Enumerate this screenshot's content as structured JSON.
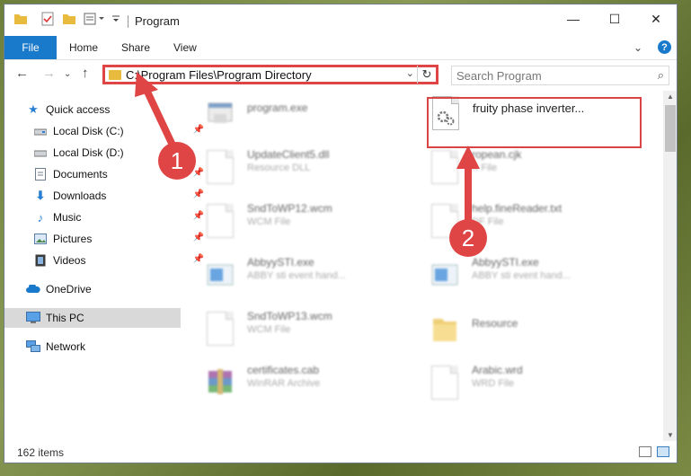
{
  "window": {
    "title": "Program",
    "controls": {
      "minimize": "—",
      "maximize": "☐",
      "close": "✕"
    }
  },
  "ribbon": {
    "tabs": [
      "File",
      "Home",
      "Share",
      "View"
    ],
    "help": "?"
  },
  "nav": {
    "address_path": "C:\\Program Files\\Program Directory",
    "search_placeholder": "Search Program"
  },
  "sidebar": {
    "items": [
      {
        "label": "Quick access",
        "icon": "star-icon",
        "pinned": false
      },
      {
        "label": "Local Disk (C:)",
        "icon": "drive-icon",
        "pinned": true
      },
      {
        "label": "Local Disk (D:)",
        "icon": "drive-icon",
        "pinned": false
      },
      {
        "label": "Documents",
        "icon": "documents-icon",
        "pinned": true
      },
      {
        "label": "Downloads",
        "icon": "download-icon",
        "pinned": true
      },
      {
        "label": "Music",
        "icon": "music-icon",
        "pinned": true
      },
      {
        "label": "Pictures",
        "icon": "pictures-icon",
        "pinned": true
      },
      {
        "label": "Videos",
        "icon": "videos-icon",
        "pinned": true
      },
      {
        "label": "OneDrive",
        "icon": "cloud-icon",
        "pinned": false
      },
      {
        "label": "This PC",
        "icon": "computer-icon",
        "pinned": false,
        "selected": true
      },
      {
        "label": "Network",
        "icon": "network-icon",
        "pinned": false
      }
    ]
  },
  "files": [
    {
      "name": "program.exe",
      "type": "",
      "icon": "exe-icon"
    },
    {
      "name": "fruity phase inverter...",
      "type": "",
      "icon": "settings-file-icon"
    },
    {
      "name": "UpdateClient5.dll",
      "type": "Resource DLL",
      "icon": "dll-icon"
    },
    {
      "name": "ropean.cjk",
      "type": "K File",
      "icon": "file-icon"
    },
    {
      "name": "SndToWP12.wcm",
      "type": "WCM File",
      "icon": "file-icon"
    },
    {
      "name": "help.fineReader.txt",
      "type": "DF File",
      "icon": "file-icon"
    },
    {
      "name": "AbbyySTI.exe",
      "type": "ABBY sti event hand...",
      "icon": "app-icon"
    },
    {
      "name": "AbbyySTI.exe",
      "type": "ABBY sti event hand...",
      "icon": "app-icon"
    },
    {
      "name": "SndToWP13.wcm",
      "type": "WCM File",
      "icon": "file-icon"
    },
    {
      "name": "Resource",
      "type": "",
      "icon": "folder-icon"
    },
    {
      "name": "certificates.cab",
      "type": "WinRAR Archive",
      "icon": "archive-icon"
    },
    {
      "name": "Arabic.wrd",
      "type": "WRD File",
      "icon": "file-icon"
    }
  ],
  "callouts": [
    "1",
    "2"
  ],
  "status": {
    "item_count": "162 items"
  },
  "colors": {
    "accent": "#1979ca",
    "annotation": "#e04545",
    "folder": "#e8bb3e"
  }
}
